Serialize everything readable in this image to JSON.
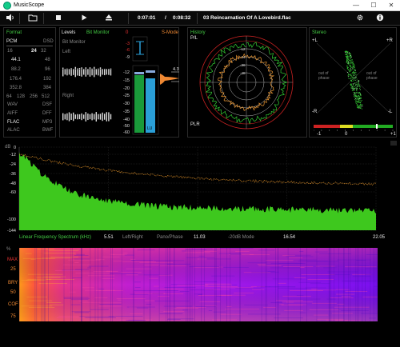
{
  "window": {
    "title": "MusicScope",
    "minimize": "—",
    "maximize": "☐",
    "close": "✕"
  },
  "toolbar": {
    "elapsed": "0:07:01",
    "separator": "/",
    "total": "0:08:32",
    "file": "03 Reincarnation Of A Lovebird.flac",
    "icons": [
      "speaker-icon",
      "folder-icon",
      "stop-icon",
      "play-icon",
      "eject-icon",
      "gear-icon",
      "info-icon"
    ]
  },
  "format_panel": {
    "title": "Format",
    "pcm": "PCM",
    "dsd": "DSD",
    "bits": [
      "16",
      "24",
      "32"
    ],
    "bits_selected": "24",
    "rates_left": [
      "44.1",
      "88.2",
      "176.4",
      "352.8"
    ],
    "rates_right": [
      "48",
      "96",
      "192",
      "384"
    ],
    "dsd_rates": [
      "64",
      "128",
      "256",
      "512"
    ],
    "formats_left": [
      "WAV",
      "AIFF",
      "FLAC",
      "ALAC"
    ],
    "formats_right": [
      "DSF",
      "DFF",
      "MP3",
      "BWF"
    ],
    "rate_selected": "44.1",
    "format_selected": "FLAC"
  },
  "levels_panel": {
    "title": "Levels",
    "bit_monitor": "Bit Monitor",
    "bit_monitor_label": "Bit Monitor",
    "left": "Left",
    "right": "Right",
    "s_mode": "S-Mode",
    "peak_value": "4.3",
    "scale": [
      "0",
      "-3",
      "-6",
      "-9",
      "-12",
      "-15",
      "-20",
      "-25",
      "-30",
      "-35",
      "-40",
      "-50",
      "-60"
    ],
    "channel_labels": [
      "LU",
      "LU"
    ]
  },
  "history_panel": {
    "title": "History",
    "pl": "P/L",
    "plr": "PLR"
  },
  "stereo_panel": {
    "title": "Stereo",
    "plus_l": "+L",
    "plus_r": "+R",
    "minus_l": "-L",
    "minus_r": "-R",
    "out_of_phase_left": "out of phase",
    "out_of_phase_right": "out of phase",
    "corr_minus": "-1",
    "corr_zero": "0",
    "corr_plus": "+1"
  },
  "spectrum_panel": {
    "db_label": "dB",
    "scale": [
      "0",
      "-12",
      "-24",
      "-36",
      "-48",
      "-60",
      "-100",
      "-144"
    ],
    "title": "Linear Frequency Spectrum (kHz)",
    "freq_ticks": [
      "5.51",
      "11.03",
      "16.54",
      "22.05"
    ],
    "modes": [
      "Left/Right",
      "Pano/Phase",
      "-20dB Mode"
    ]
  },
  "spectrogram_panel": {
    "percent": "%",
    "labels": [
      "MAX",
      "25",
      "BRY",
      "50",
      "COF",
      "75"
    ]
  },
  "colors": {
    "accent_green": "#44cc44",
    "accent_orange": "#ee8833",
    "accent_red": "#ee3333",
    "meter_blue": "#2a9fd8"
  }
}
